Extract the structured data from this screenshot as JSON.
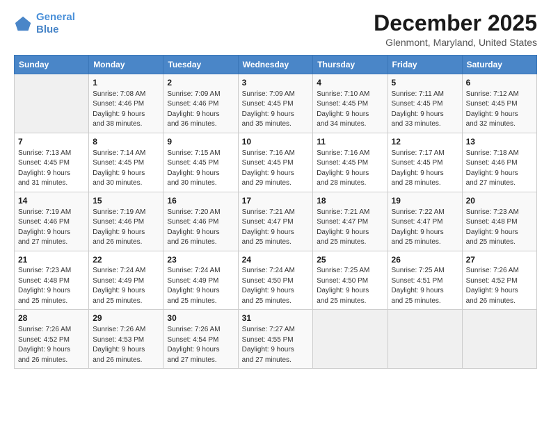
{
  "header": {
    "logo_line1": "General",
    "logo_line2": "Blue",
    "month": "December 2025",
    "location": "Glenmont, Maryland, United States"
  },
  "days_of_week": [
    "Sunday",
    "Monday",
    "Tuesday",
    "Wednesday",
    "Thursday",
    "Friday",
    "Saturday"
  ],
  "weeks": [
    [
      {
        "day": "",
        "info": ""
      },
      {
        "day": "1",
        "info": "Sunrise: 7:08 AM\nSunset: 4:46 PM\nDaylight: 9 hours\nand 38 minutes."
      },
      {
        "day": "2",
        "info": "Sunrise: 7:09 AM\nSunset: 4:46 PM\nDaylight: 9 hours\nand 36 minutes."
      },
      {
        "day": "3",
        "info": "Sunrise: 7:09 AM\nSunset: 4:45 PM\nDaylight: 9 hours\nand 35 minutes."
      },
      {
        "day": "4",
        "info": "Sunrise: 7:10 AM\nSunset: 4:45 PM\nDaylight: 9 hours\nand 34 minutes."
      },
      {
        "day": "5",
        "info": "Sunrise: 7:11 AM\nSunset: 4:45 PM\nDaylight: 9 hours\nand 33 minutes."
      },
      {
        "day": "6",
        "info": "Sunrise: 7:12 AM\nSunset: 4:45 PM\nDaylight: 9 hours\nand 32 minutes."
      }
    ],
    [
      {
        "day": "7",
        "info": "Sunrise: 7:13 AM\nSunset: 4:45 PM\nDaylight: 9 hours\nand 31 minutes."
      },
      {
        "day": "8",
        "info": "Sunrise: 7:14 AM\nSunset: 4:45 PM\nDaylight: 9 hours\nand 30 minutes."
      },
      {
        "day": "9",
        "info": "Sunrise: 7:15 AM\nSunset: 4:45 PM\nDaylight: 9 hours\nand 30 minutes."
      },
      {
        "day": "10",
        "info": "Sunrise: 7:16 AM\nSunset: 4:45 PM\nDaylight: 9 hours\nand 29 minutes."
      },
      {
        "day": "11",
        "info": "Sunrise: 7:16 AM\nSunset: 4:45 PM\nDaylight: 9 hours\nand 28 minutes."
      },
      {
        "day": "12",
        "info": "Sunrise: 7:17 AM\nSunset: 4:45 PM\nDaylight: 9 hours\nand 28 minutes."
      },
      {
        "day": "13",
        "info": "Sunrise: 7:18 AM\nSunset: 4:46 PM\nDaylight: 9 hours\nand 27 minutes."
      }
    ],
    [
      {
        "day": "14",
        "info": "Sunrise: 7:19 AM\nSunset: 4:46 PM\nDaylight: 9 hours\nand 27 minutes."
      },
      {
        "day": "15",
        "info": "Sunrise: 7:19 AM\nSunset: 4:46 PM\nDaylight: 9 hours\nand 26 minutes."
      },
      {
        "day": "16",
        "info": "Sunrise: 7:20 AM\nSunset: 4:46 PM\nDaylight: 9 hours\nand 26 minutes."
      },
      {
        "day": "17",
        "info": "Sunrise: 7:21 AM\nSunset: 4:47 PM\nDaylight: 9 hours\nand 25 minutes."
      },
      {
        "day": "18",
        "info": "Sunrise: 7:21 AM\nSunset: 4:47 PM\nDaylight: 9 hours\nand 25 minutes."
      },
      {
        "day": "19",
        "info": "Sunrise: 7:22 AM\nSunset: 4:47 PM\nDaylight: 9 hours\nand 25 minutes."
      },
      {
        "day": "20",
        "info": "Sunrise: 7:23 AM\nSunset: 4:48 PM\nDaylight: 9 hours\nand 25 minutes."
      }
    ],
    [
      {
        "day": "21",
        "info": "Sunrise: 7:23 AM\nSunset: 4:48 PM\nDaylight: 9 hours\nand 25 minutes."
      },
      {
        "day": "22",
        "info": "Sunrise: 7:24 AM\nSunset: 4:49 PM\nDaylight: 9 hours\nand 25 minutes."
      },
      {
        "day": "23",
        "info": "Sunrise: 7:24 AM\nSunset: 4:49 PM\nDaylight: 9 hours\nand 25 minutes."
      },
      {
        "day": "24",
        "info": "Sunrise: 7:24 AM\nSunset: 4:50 PM\nDaylight: 9 hours\nand 25 minutes."
      },
      {
        "day": "25",
        "info": "Sunrise: 7:25 AM\nSunset: 4:50 PM\nDaylight: 9 hours\nand 25 minutes."
      },
      {
        "day": "26",
        "info": "Sunrise: 7:25 AM\nSunset: 4:51 PM\nDaylight: 9 hours\nand 25 minutes."
      },
      {
        "day": "27",
        "info": "Sunrise: 7:26 AM\nSunset: 4:52 PM\nDaylight: 9 hours\nand 26 minutes."
      }
    ],
    [
      {
        "day": "28",
        "info": "Sunrise: 7:26 AM\nSunset: 4:52 PM\nDaylight: 9 hours\nand 26 minutes."
      },
      {
        "day": "29",
        "info": "Sunrise: 7:26 AM\nSunset: 4:53 PM\nDaylight: 9 hours\nand 26 minutes."
      },
      {
        "day": "30",
        "info": "Sunrise: 7:26 AM\nSunset: 4:54 PM\nDaylight: 9 hours\nand 27 minutes."
      },
      {
        "day": "31",
        "info": "Sunrise: 7:27 AM\nSunset: 4:55 PM\nDaylight: 9 hours\nand 27 minutes."
      },
      {
        "day": "",
        "info": ""
      },
      {
        "day": "",
        "info": ""
      },
      {
        "day": "",
        "info": ""
      }
    ]
  ]
}
